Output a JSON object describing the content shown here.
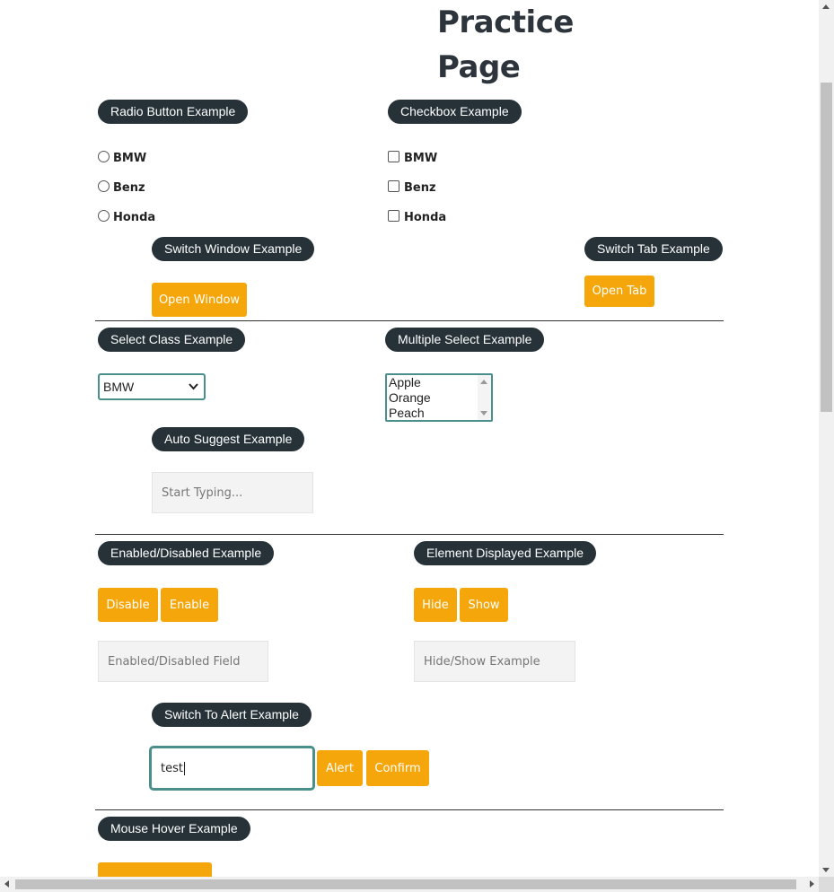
{
  "page": {
    "title": "Practice Page"
  },
  "radio": {
    "header": "Radio Button Example",
    "options": [
      "BMW",
      "Benz",
      "Honda"
    ]
  },
  "checkbox": {
    "header": "Checkbox Example",
    "options": [
      "BMW",
      "Benz",
      "Honda"
    ]
  },
  "switch_window": {
    "header": "Switch Window Example",
    "button": "Open Window"
  },
  "switch_tab": {
    "header": "Switch Tab Example",
    "button": "Open Tab"
  },
  "select_class": {
    "header": "Select Class Example",
    "selected": "BMW"
  },
  "multiple_select": {
    "header": "Multiple Select Example",
    "options": [
      "Apple",
      "Orange",
      "Peach"
    ]
  },
  "auto_suggest": {
    "header": "Auto Suggest Example",
    "placeholder": "Start Typing..."
  },
  "enabled_disabled": {
    "header": "Enabled/Disabled Example",
    "disable_button": "Disable",
    "enable_button": "Enable",
    "placeholder": "Enabled/Disabled Field"
  },
  "element_displayed": {
    "header": "Element Displayed Example",
    "hide_button": "Hide",
    "show_button": "Show",
    "placeholder": "Hide/Show Example"
  },
  "alert": {
    "header": "Switch To Alert Example",
    "input_value": "test",
    "alert_button": "Alert",
    "confirm_button": "Confirm"
  },
  "mouse_hover": {
    "header": "Mouse Hover Example"
  },
  "colors": {
    "accent": "#f5a60b",
    "pill_bg": "#263238",
    "focus_border": "#4a8f8b"
  }
}
